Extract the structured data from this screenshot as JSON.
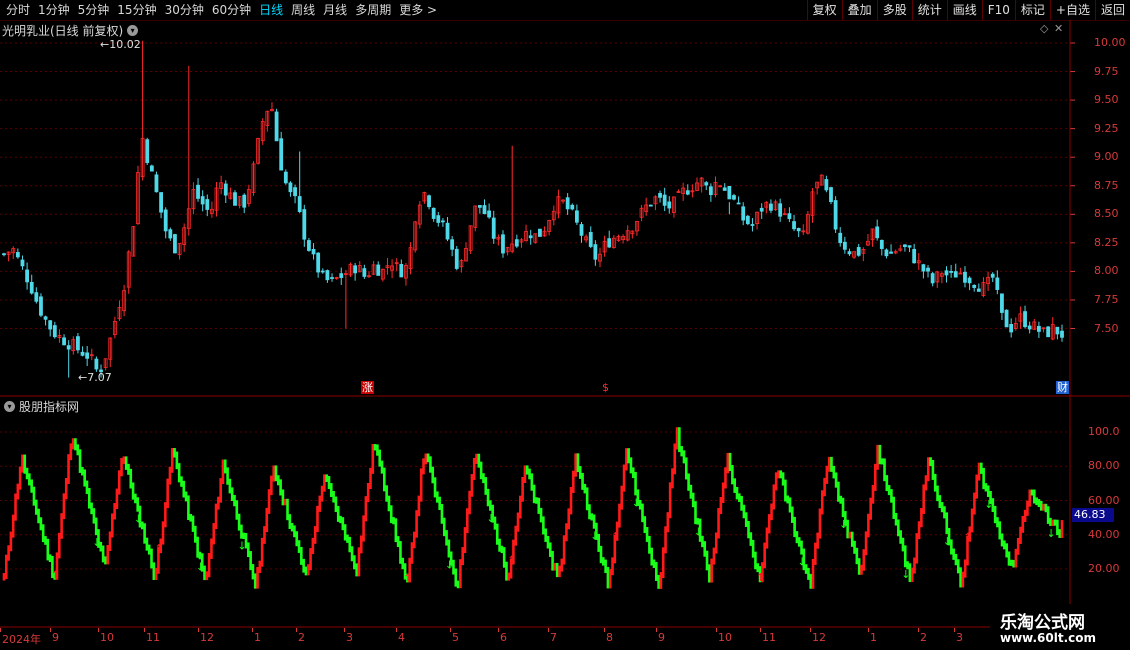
{
  "toolbar": {
    "periods": [
      "分时",
      "1分钟",
      "5分钟",
      "15分钟",
      "30分钟",
      "60分钟",
      "日线",
      "周线",
      "月线",
      "多周期",
      "更多 >"
    ],
    "active_period": "日线",
    "tools": [
      "复权",
      "叠加",
      "多股",
      "统计",
      "画线",
      "F10",
      "标记",
      "+自选",
      "返回"
    ]
  },
  "main_panel": {
    "title": "光明乳业(日线 前复权)",
    "high_annotation": "10.02",
    "low_annotation": "7.07",
    "markers": {
      "zhang": "涨",
      "dollar": "$",
      "cai": "财"
    },
    "y_axis": [
      "10.00",
      "9.75",
      "9.50",
      "9.25",
      "9.00",
      "8.75",
      "8.50",
      "8.25",
      "8.00",
      "7.75",
      "7.50"
    ]
  },
  "indicator_panel": {
    "title": "股朋指标网",
    "y_axis": [
      "100.0",
      "80.00",
      "60.00",
      "40.00",
      "20.00"
    ],
    "current_value": "46.83"
  },
  "x_axis": {
    "labels": [
      "2024年",
      "9",
      "10",
      "11",
      "12",
      "1",
      "2",
      "3",
      "4",
      "5",
      "6",
      "7",
      "8",
      "9",
      "10",
      "11",
      "12",
      "1",
      "2",
      "3"
    ]
  },
  "watermark": {
    "line1": "乐淘公式网",
    "line2": "www.60lt.com"
  },
  "colors": {
    "up": "#ff2a2a",
    "down": "#4fd8e8",
    "ind_up": "#ff1a1a",
    "ind_down": "#1aff1a",
    "grid": "#5a0000",
    "axis": "#d63a3a"
  },
  "chart_data": [
    {
      "type": "candlestick",
      "title": "光明乳业(日线 前复权)",
      "ylim": [
        7.0,
        10.2
      ],
      "ticks": [
        7.5,
        7.75,
        8.0,
        8.25,
        8.5,
        8.75,
        9.0,
        9.25,
        9.5,
        9.75,
        10.0
      ],
      "annotations": {
        "high": 10.02,
        "low": 7.07
      },
      "close_path": [
        8.15,
        8.2,
        8.05,
        7.9,
        7.7,
        7.55,
        7.45,
        7.4,
        7.35,
        7.3,
        7.25,
        7.1,
        7.3,
        7.6,
        7.9,
        8.4,
        9.2,
        8.9,
        8.6,
        8.3,
        8.2,
        8.4,
        8.7,
        8.6,
        8.5,
        8.8,
        8.7,
        8.6,
        8.6,
        8.9,
        9.3,
        9.5,
        9.0,
        8.7,
        8.6,
        8.3,
        8.1,
        7.95,
        7.9,
        7.95,
        8.0,
        8.05,
        7.95,
        8.05,
        8.0,
        8.1,
        8.0,
        8.05,
        8.6,
        8.7,
        8.5,
        8.4,
        8.2,
        8.0,
        8.35,
        8.6,
        8.5,
        8.3,
        8.2,
        8.25,
        8.3,
        8.35,
        8.3,
        8.4,
        8.6,
        8.6,
        8.5,
        8.35,
        8.2,
        8.1,
        8.25,
        8.3,
        8.35,
        8.4,
        8.5,
        8.6,
        8.65,
        8.55,
        8.6,
        8.7,
        8.75,
        8.8,
        8.7,
        8.8,
        8.7,
        8.6,
        8.45,
        8.4,
        8.55,
        8.6,
        8.55,
        8.45,
        8.35,
        8.3,
        8.7,
        8.8,
        8.6,
        8.3,
        8.2,
        8.15,
        8.2,
        8.35,
        8.2,
        8.15,
        8.2,
        8.2,
        8.1,
        8.0,
        7.9,
        8.0,
        7.95,
        8.0,
        7.95,
        7.9,
        7.85,
        7.95,
        7.6,
        7.5,
        7.6,
        7.55,
        7.5,
        7.45,
        7.5,
        7.45
      ]
    },
    {
      "type": "bar",
      "title": "股朋指标网",
      "ylim": [
        0,
        115
      ],
      "ticks": [
        20,
        40,
        60,
        80,
        100
      ],
      "current_value": 46.83,
      "cycle_peaks": [
        85,
        100,
        88,
        90,
        82,
        80,
        75,
        95,
        90,
        88,
        80,
        85,
        90,
        100,
        85,
        80,
        85,
        90,
        85,
        80,
        65
      ],
      "cycle_troughs": [
        15,
        20,
        15,
        12,
        10,
        15,
        20,
        10,
        10,
        15,
        12,
        10,
        8,
        15,
        15,
        10,
        15,
        12,
        10,
        20,
        40
      ]
    }
  ]
}
